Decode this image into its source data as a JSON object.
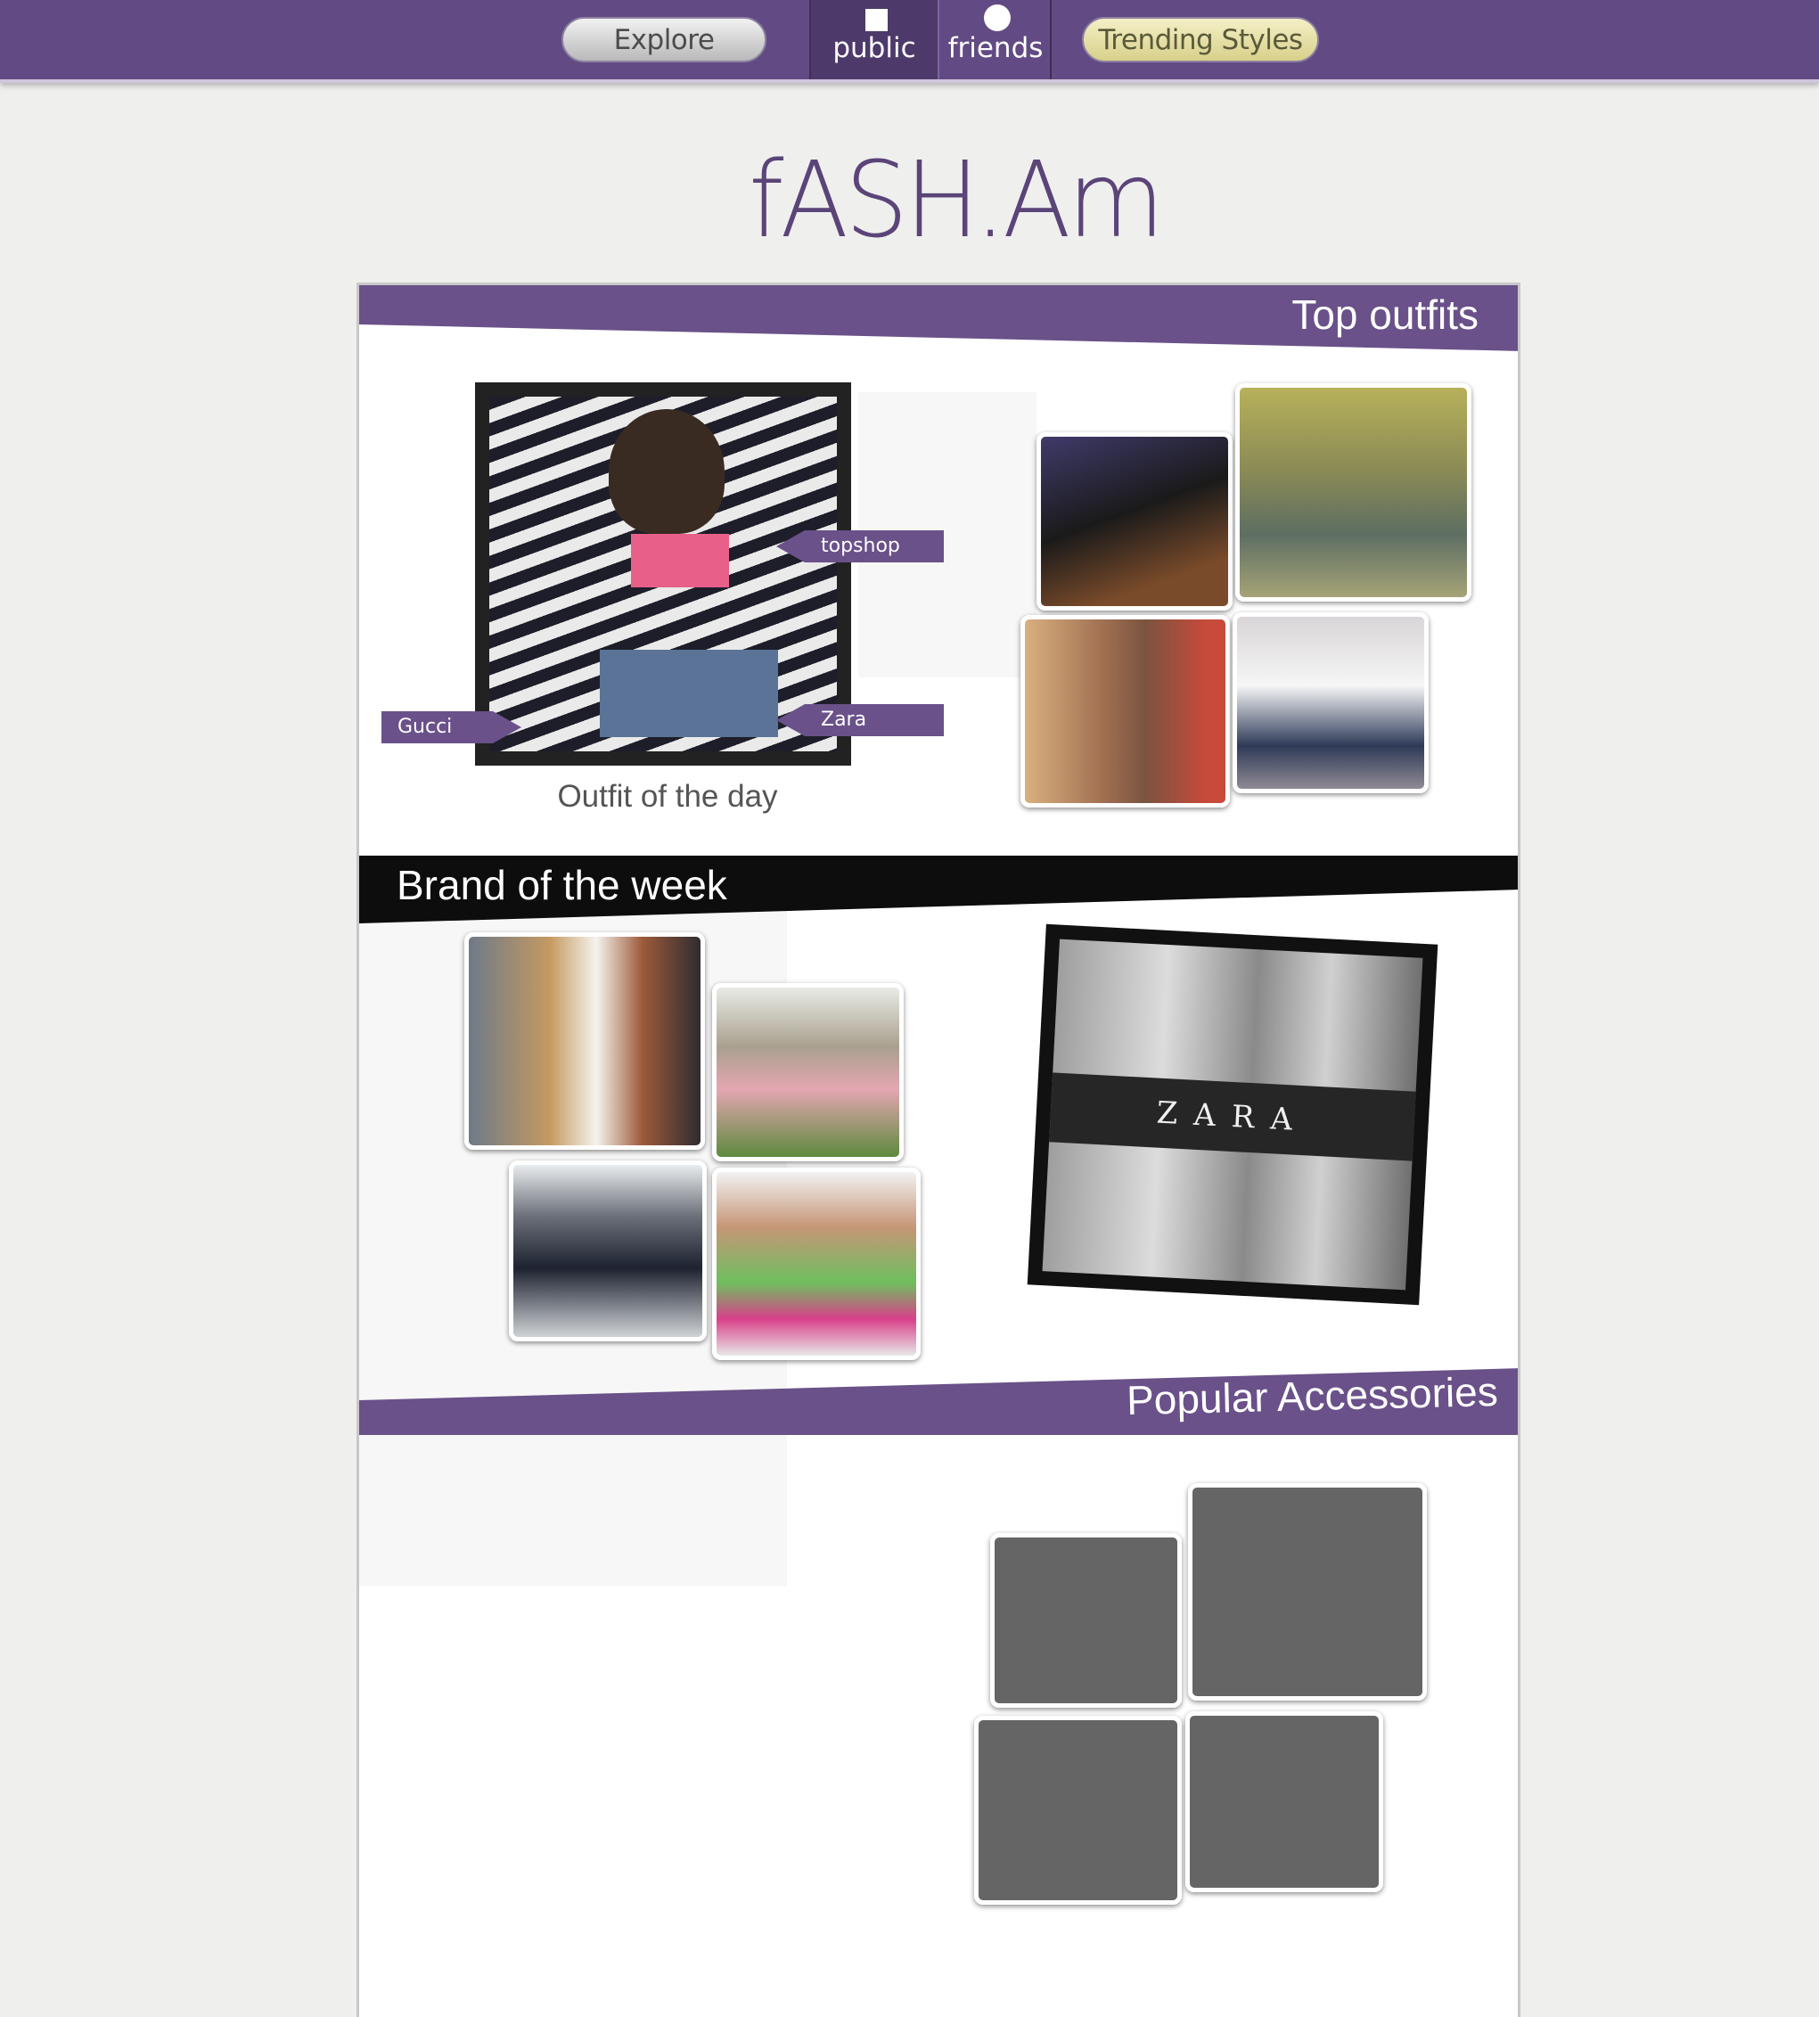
{
  "nav": {
    "explore_label": "Explore",
    "public_label": "public",
    "friends_label": "friends",
    "trending_label": "Trending Styles"
  },
  "brand": {
    "logo_text": "fASH.Am"
  },
  "sections": {
    "top_outfits": {
      "title": "Top outfits",
      "outfit_of_day_caption": "Outfit of the day",
      "tags": [
        "topshop",
        "Zara",
        "Gucci"
      ]
    },
    "brand_of_week": {
      "title": "Brand of the week",
      "brand_name": "ZARA"
    },
    "popular_accessories": {
      "title": "Popular Accessories"
    }
  },
  "colors": {
    "nav_bg": "#624b84",
    "accent_purple": "#6a5189",
    "band_black": "#0d0d0d"
  }
}
